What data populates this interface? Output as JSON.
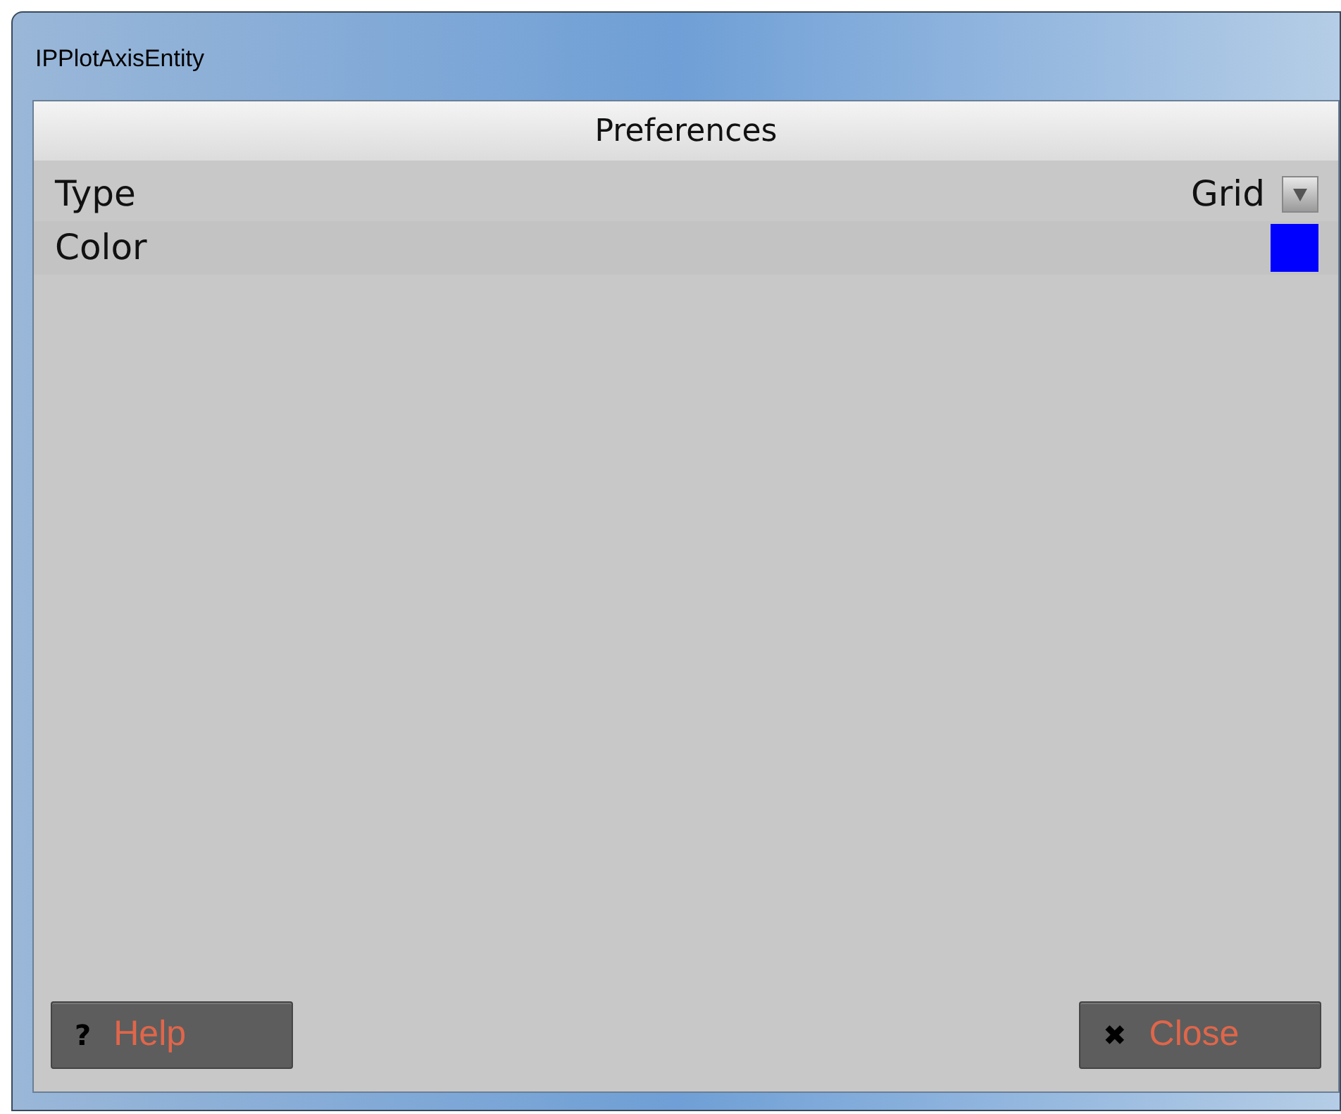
{
  "window": {
    "title": "IPPlotAxisEntity"
  },
  "panel": {
    "title": "Preferences"
  },
  "properties": [
    {
      "kind": "dropdown",
      "label": "Type",
      "value": "Grid"
    },
    {
      "kind": "color",
      "label": "Color",
      "color": "#0000ff"
    }
  ],
  "buttons": [
    {
      "icon": "?",
      "label": "Help"
    },
    {
      "icon": "✖",
      "label": "Close"
    }
  ]
}
